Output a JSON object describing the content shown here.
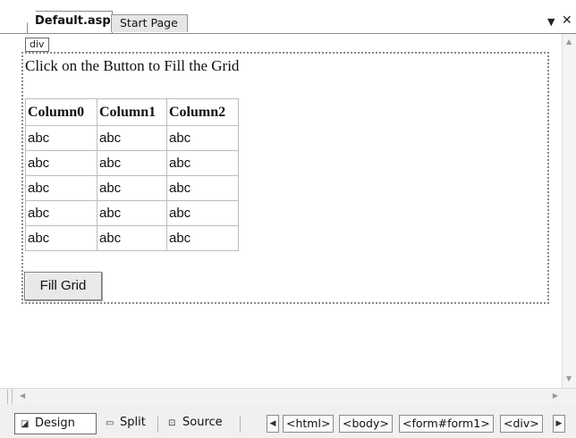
{
  "tabs": [
    {
      "label": "Default.aspx",
      "active": true
    },
    {
      "label": "Start Page",
      "active": false
    }
  ],
  "window_buttons": {
    "dropdown": "▼",
    "close": "✕"
  },
  "design_surface": {
    "div_tag": "div",
    "intro_text": "Click on the Button to Fill the Grid",
    "grid": {
      "columns": [
        "Column0",
        "Column1",
        "Column2"
      ],
      "rows": [
        [
          "abc",
          "abc",
          "abc"
        ],
        [
          "abc",
          "abc",
          "abc"
        ],
        [
          "abc",
          "abc",
          "abc"
        ],
        [
          "abc",
          "abc",
          "abc"
        ],
        [
          "abc",
          "abc",
          "abc"
        ]
      ]
    },
    "button_label": "Fill Grid"
  },
  "view_bar": {
    "design": "Design",
    "split": "Split",
    "source": "Source",
    "design_icon": "design-view-icon",
    "split_icon": "split-view-icon",
    "source_icon": "source-view-icon"
  },
  "breadcrumb": [
    "<html>",
    "<body>",
    "<form#form1>",
    "<div>"
  ]
}
